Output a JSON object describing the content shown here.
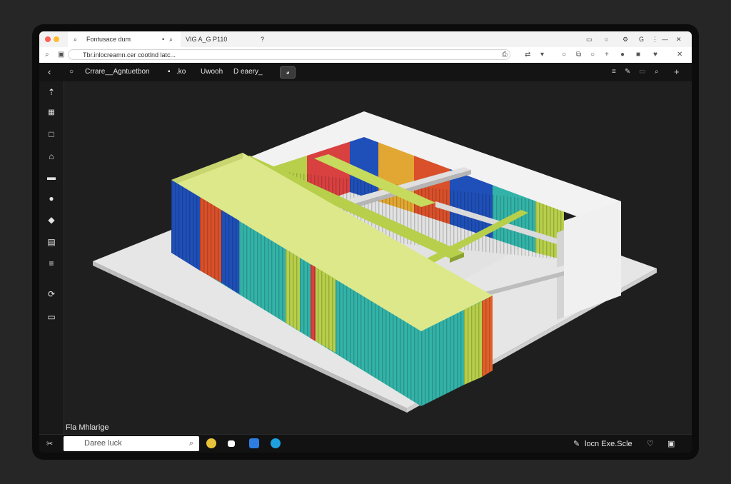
{
  "browser": {
    "tabs": [
      {
        "label": "Fontusace dum",
        "active": true
      },
      {
        "label": "VIG A_G P110",
        "active": false
      }
    ],
    "tab_right_icons": [
      "bookmark-icon",
      "settings-icon",
      "g-icon",
      "more-icon",
      "minimize-icon",
      "close-icon"
    ],
    "url": "Tbr.inlocreamn.cer cootlnd latc...",
    "colors": {
      "close_dot": "#ff5f57",
      "min_dot": "#febc2e"
    }
  },
  "toolbar": {
    "items": [
      {
        "label": "Crrare__Agntuetbon"
      },
      {
        "label": ".ko"
      },
      {
        "label": "Uwooh"
      },
      {
        "label": "D eaery_"
      }
    ]
  },
  "sidebar": {
    "icons": [
      "pin-icon",
      "qr-icon",
      "square-icon",
      "home-icon",
      "print-icon",
      "user-icon",
      "tag-icon",
      "printer-icon",
      "list-icon",
      "refresh-icon",
      "window-icon"
    ]
  },
  "viewport": {
    "label": "Fla Mhlarige",
    "model_colors": [
      "#1f4fb8",
      "#d9502a",
      "#33b3a8",
      "#b7cf4a",
      "#e2a732",
      "#dcdcdc"
    ]
  },
  "taskbar": {
    "search_placeholder": "Daree luck",
    "tray_text": "locn Exe.Scle",
    "app_colors": [
      "#e8c43a",
      "#4a90e2",
      "#2e7de0",
      "#1fa0e0"
    ]
  }
}
